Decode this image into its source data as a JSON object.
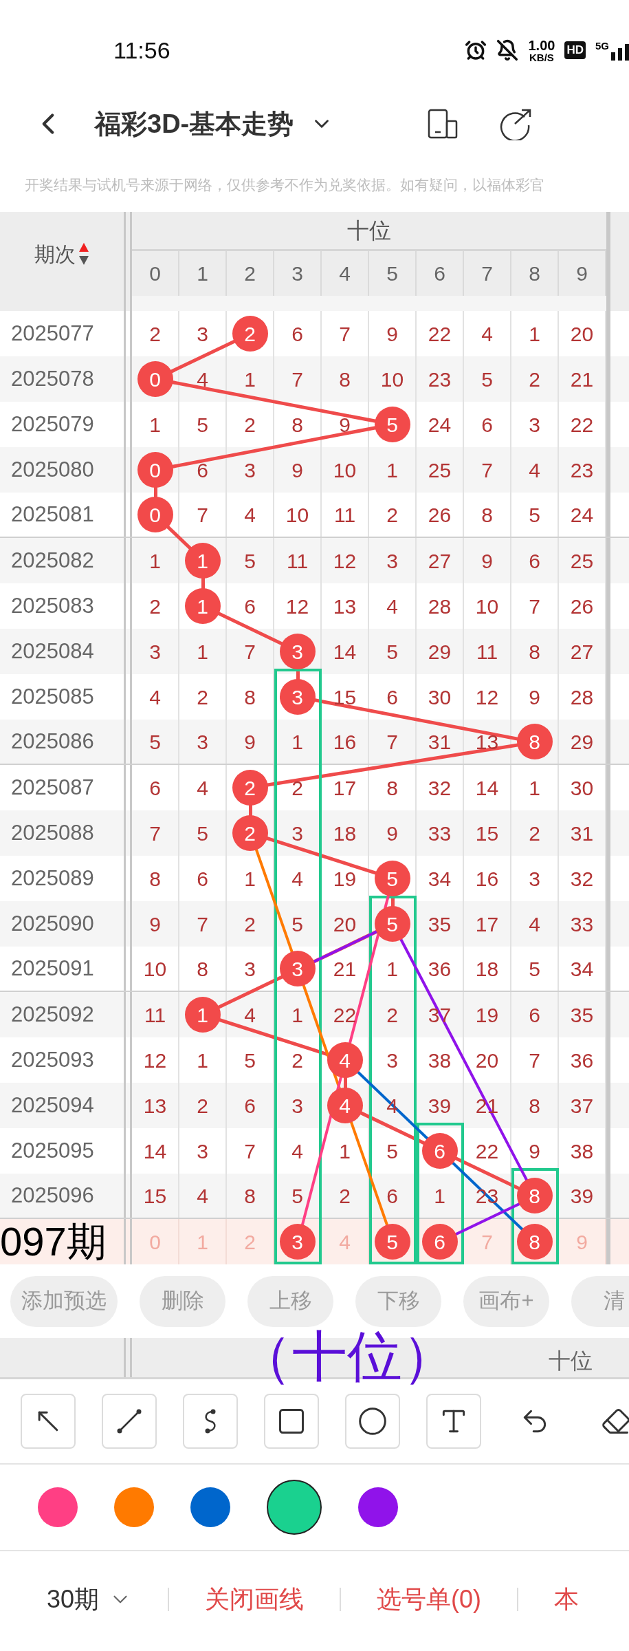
{
  "status_bar": {
    "time": "11:56",
    "speed": "1.00",
    "speed_unit": "KB/S",
    "hd": "HD",
    "network": "5G"
  },
  "header": {
    "title": "福彩3D-基本走势"
  },
  "notice": "开奖结果与试机号来源于网络，仅供参考不作为兑奖依据。如有疑问，以福体彩官",
  "table": {
    "issue_heading": "期次",
    "group_heading": "十位",
    "columns": [
      "0",
      "1",
      "2",
      "3",
      "4",
      "5",
      "6",
      "7",
      "8",
      "9"
    ],
    "rows": [
      {
        "issue": "2025077",
        "cells": [
          {
            "value": "2",
            "hit": false
          },
          {
            "value": "3",
            "hit": false
          },
          {
            "value": "2",
            "hit": true
          },
          {
            "value": "6",
            "hit": false
          },
          {
            "value": "7",
            "hit": false
          },
          {
            "value": "9",
            "hit": false
          },
          {
            "value": "22",
            "hit": false
          },
          {
            "value": "4",
            "hit": false
          },
          {
            "value": "1",
            "hit": false
          },
          {
            "value": "20",
            "hit": false
          }
        ]
      },
      {
        "issue": "2025078",
        "cells": [
          {
            "value": "0",
            "hit": true
          },
          {
            "value": "4",
            "hit": false
          },
          {
            "value": "1",
            "hit": false
          },
          {
            "value": "7",
            "hit": false
          },
          {
            "value": "8",
            "hit": false
          },
          {
            "value": "10",
            "hit": false
          },
          {
            "value": "23",
            "hit": false
          },
          {
            "value": "5",
            "hit": false
          },
          {
            "value": "2",
            "hit": false
          },
          {
            "value": "21",
            "hit": false
          }
        ]
      },
      {
        "issue": "2025079",
        "cells": [
          {
            "value": "1",
            "hit": false
          },
          {
            "value": "5",
            "hit": false
          },
          {
            "value": "2",
            "hit": false
          },
          {
            "value": "8",
            "hit": false
          },
          {
            "value": "9",
            "hit": false
          },
          {
            "value": "5",
            "hit": true
          },
          {
            "value": "24",
            "hit": false
          },
          {
            "value": "6",
            "hit": false
          },
          {
            "value": "3",
            "hit": false
          },
          {
            "value": "22",
            "hit": false
          }
        ]
      },
      {
        "issue": "2025080",
        "cells": [
          {
            "value": "0",
            "hit": true
          },
          {
            "value": "6",
            "hit": false
          },
          {
            "value": "3",
            "hit": false
          },
          {
            "value": "9",
            "hit": false
          },
          {
            "value": "10",
            "hit": false
          },
          {
            "value": "1",
            "hit": false
          },
          {
            "value": "25",
            "hit": false
          },
          {
            "value": "7",
            "hit": false
          },
          {
            "value": "4",
            "hit": false
          },
          {
            "value": "23",
            "hit": false
          }
        ]
      },
      {
        "issue": "2025081",
        "cells": [
          {
            "value": "0",
            "hit": true
          },
          {
            "value": "7",
            "hit": false
          },
          {
            "value": "4",
            "hit": false
          },
          {
            "value": "10",
            "hit": false
          },
          {
            "value": "11",
            "hit": false
          },
          {
            "value": "2",
            "hit": false
          },
          {
            "value": "26",
            "hit": false
          },
          {
            "value": "8",
            "hit": false
          },
          {
            "value": "5",
            "hit": false
          },
          {
            "value": "24",
            "hit": false
          }
        ]
      },
      {
        "issue": "2025082",
        "cells": [
          {
            "value": "1",
            "hit": false
          },
          {
            "value": "1",
            "hit": true
          },
          {
            "value": "5",
            "hit": false
          },
          {
            "value": "11",
            "hit": false
          },
          {
            "value": "12",
            "hit": false
          },
          {
            "value": "3",
            "hit": false
          },
          {
            "value": "27",
            "hit": false
          },
          {
            "value": "9",
            "hit": false
          },
          {
            "value": "6",
            "hit": false
          },
          {
            "value": "25",
            "hit": false
          }
        ]
      },
      {
        "issue": "2025083",
        "cells": [
          {
            "value": "2",
            "hit": false
          },
          {
            "value": "1",
            "hit": true
          },
          {
            "value": "6",
            "hit": false
          },
          {
            "value": "12",
            "hit": false
          },
          {
            "value": "13",
            "hit": false
          },
          {
            "value": "4",
            "hit": false
          },
          {
            "value": "28",
            "hit": false
          },
          {
            "value": "10",
            "hit": false
          },
          {
            "value": "7",
            "hit": false
          },
          {
            "value": "26",
            "hit": false
          }
        ]
      },
      {
        "issue": "2025084",
        "cells": [
          {
            "value": "3",
            "hit": false
          },
          {
            "value": "1",
            "hit": false
          },
          {
            "value": "7",
            "hit": false
          },
          {
            "value": "3",
            "hit": true
          },
          {
            "value": "14",
            "hit": false
          },
          {
            "value": "5",
            "hit": false
          },
          {
            "value": "29",
            "hit": false
          },
          {
            "value": "11",
            "hit": false
          },
          {
            "value": "8",
            "hit": false
          },
          {
            "value": "27",
            "hit": false
          }
        ]
      },
      {
        "issue": "2025085",
        "cells": [
          {
            "value": "4",
            "hit": false
          },
          {
            "value": "2",
            "hit": false
          },
          {
            "value": "8",
            "hit": false
          },
          {
            "value": "3",
            "hit": true
          },
          {
            "value": "15",
            "hit": false
          },
          {
            "value": "6",
            "hit": false
          },
          {
            "value": "30",
            "hit": false
          },
          {
            "value": "12",
            "hit": false
          },
          {
            "value": "9",
            "hit": false
          },
          {
            "value": "28",
            "hit": false
          }
        ]
      },
      {
        "issue": "2025086",
        "cells": [
          {
            "value": "5",
            "hit": false
          },
          {
            "value": "3",
            "hit": false
          },
          {
            "value": "9",
            "hit": false
          },
          {
            "value": "1",
            "hit": false
          },
          {
            "value": "16",
            "hit": false
          },
          {
            "value": "7",
            "hit": false
          },
          {
            "value": "31",
            "hit": false
          },
          {
            "value": "13",
            "hit": false
          },
          {
            "value": "8",
            "hit": true
          },
          {
            "value": "29",
            "hit": false
          }
        ]
      },
      {
        "issue": "2025087",
        "cells": [
          {
            "value": "6",
            "hit": false
          },
          {
            "value": "4",
            "hit": false
          },
          {
            "value": "2",
            "hit": true
          },
          {
            "value": "2",
            "hit": false
          },
          {
            "value": "17",
            "hit": false
          },
          {
            "value": "8",
            "hit": false
          },
          {
            "value": "32",
            "hit": false
          },
          {
            "value": "14",
            "hit": false
          },
          {
            "value": "1",
            "hit": false
          },
          {
            "value": "30",
            "hit": false
          }
        ]
      },
      {
        "issue": "2025088",
        "cells": [
          {
            "value": "7",
            "hit": false
          },
          {
            "value": "5",
            "hit": false
          },
          {
            "value": "2",
            "hit": true
          },
          {
            "value": "3",
            "hit": false
          },
          {
            "value": "18",
            "hit": false
          },
          {
            "value": "9",
            "hit": false
          },
          {
            "value": "33",
            "hit": false
          },
          {
            "value": "15",
            "hit": false
          },
          {
            "value": "2",
            "hit": false
          },
          {
            "value": "31",
            "hit": false
          }
        ]
      },
      {
        "issue": "2025089",
        "cells": [
          {
            "value": "8",
            "hit": false
          },
          {
            "value": "6",
            "hit": false
          },
          {
            "value": "1",
            "hit": false
          },
          {
            "value": "4",
            "hit": false
          },
          {
            "value": "19",
            "hit": false
          },
          {
            "value": "5",
            "hit": true
          },
          {
            "value": "34",
            "hit": false
          },
          {
            "value": "16",
            "hit": false
          },
          {
            "value": "3",
            "hit": false
          },
          {
            "value": "32",
            "hit": false
          }
        ]
      },
      {
        "issue": "2025090",
        "cells": [
          {
            "value": "9",
            "hit": false
          },
          {
            "value": "7",
            "hit": false
          },
          {
            "value": "2",
            "hit": false
          },
          {
            "value": "5",
            "hit": false
          },
          {
            "value": "20",
            "hit": false
          },
          {
            "value": "5",
            "hit": true
          },
          {
            "value": "35",
            "hit": false
          },
          {
            "value": "17",
            "hit": false
          },
          {
            "value": "4",
            "hit": false
          },
          {
            "value": "33",
            "hit": false
          }
        ]
      },
      {
        "issue": "2025091",
        "cells": [
          {
            "value": "10",
            "hit": false
          },
          {
            "value": "8",
            "hit": false
          },
          {
            "value": "3",
            "hit": false
          },
          {
            "value": "3",
            "hit": true
          },
          {
            "value": "21",
            "hit": false
          },
          {
            "value": "1",
            "hit": false
          },
          {
            "value": "36",
            "hit": false
          },
          {
            "value": "18",
            "hit": false
          },
          {
            "value": "5",
            "hit": false
          },
          {
            "value": "34",
            "hit": false
          }
        ]
      },
      {
        "issue": "2025092",
        "cells": [
          {
            "value": "11",
            "hit": false
          },
          {
            "value": "1",
            "hit": true
          },
          {
            "value": "4",
            "hit": false
          },
          {
            "value": "1",
            "hit": false
          },
          {
            "value": "22",
            "hit": false
          },
          {
            "value": "2",
            "hit": false
          },
          {
            "value": "37",
            "hit": false
          },
          {
            "value": "19",
            "hit": false
          },
          {
            "value": "6",
            "hit": false
          },
          {
            "value": "35",
            "hit": false
          }
        ]
      },
      {
        "issue": "2025093",
        "cells": [
          {
            "value": "12",
            "hit": false
          },
          {
            "value": "1",
            "hit": false
          },
          {
            "value": "5",
            "hit": false
          },
          {
            "value": "2",
            "hit": false
          },
          {
            "value": "4",
            "hit": true
          },
          {
            "value": "3",
            "hit": false
          },
          {
            "value": "38",
            "hit": false
          },
          {
            "value": "20",
            "hit": false
          },
          {
            "value": "7",
            "hit": false
          },
          {
            "value": "36",
            "hit": false
          }
        ]
      },
      {
        "issue": "2025094",
        "cells": [
          {
            "value": "13",
            "hit": false
          },
          {
            "value": "2",
            "hit": false
          },
          {
            "value": "6",
            "hit": false
          },
          {
            "value": "3",
            "hit": false
          },
          {
            "value": "4",
            "hit": true
          },
          {
            "value": "4",
            "hit": false
          },
          {
            "value": "39",
            "hit": false
          },
          {
            "value": "21",
            "hit": false
          },
          {
            "value": "8",
            "hit": false
          },
          {
            "value": "37",
            "hit": false
          }
        ]
      },
      {
        "issue": "2025095",
        "cells": [
          {
            "value": "14",
            "hit": false
          },
          {
            "value": "3",
            "hit": false
          },
          {
            "value": "7",
            "hit": false
          },
          {
            "value": "4",
            "hit": false
          },
          {
            "value": "1",
            "hit": false
          },
          {
            "value": "5",
            "hit": false
          },
          {
            "value": "6",
            "hit": true
          },
          {
            "value": "22",
            "hit": false
          },
          {
            "value": "9",
            "hit": false
          },
          {
            "value": "38",
            "hit": false
          }
        ]
      },
      {
        "issue": "2025096",
        "cells": [
          {
            "value": "15",
            "hit": false
          },
          {
            "value": "4",
            "hit": false
          },
          {
            "value": "8",
            "hit": false
          },
          {
            "value": "5",
            "hit": false
          },
          {
            "value": "2",
            "hit": false
          },
          {
            "value": "6",
            "hit": false
          },
          {
            "value": "1",
            "hit": false
          },
          {
            "value": "23",
            "hit": false
          },
          {
            "value": "8",
            "hit": true
          },
          {
            "value": "39",
            "hit": false
          }
        ]
      }
    ],
    "forecast": {
      "annotation": "097期",
      "cells": [
        {
          "value": "0",
          "hit": false
        },
        {
          "value": "1",
          "hit": false
        },
        {
          "value": "2",
          "hit": false
        },
        {
          "value": "3",
          "hit": true
        },
        {
          "value": "4",
          "hit": false
        },
        {
          "value": "5",
          "hit": true
        },
        {
          "value": "6",
          "hit": true
        },
        {
          "value": "7",
          "hit": false
        },
        {
          "value": "8",
          "hit": true
        },
        {
          "value": "9",
          "hit": false
        }
      ]
    }
  },
  "actions": [
    "添加预选",
    "删除",
    "上移",
    "下移",
    "画布+",
    "清"
  ],
  "overlay_label": "（十位）",
  "second_heading": "十位",
  "tools": [
    {
      "kind": "arrow"
    },
    {
      "kind": "line"
    },
    {
      "kind": "curve"
    },
    {
      "kind": "rect"
    },
    {
      "kind": "circle"
    },
    {
      "kind": "text"
    },
    {
      "kind": "undo"
    },
    {
      "kind": "eraser"
    }
  ],
  "palette": [
    {
      "color": "#ff3f84",
      "selected": false
    },
    {
      "color": "#ff7a00",
      "selected": false
    },
    {
      "color": "#0066cc",
      "selected": false
    },
    {
      "color": "#1ad18f",
      "selected": true
    },
    {
      "color": "#9013ea",
      "selected": false
    }
  ],
  "bottom_bar": {
    "period": "30期",
    "links": [
      "关闭画线",
      "选号单(0)",
      "本"
    ]
  }
}
